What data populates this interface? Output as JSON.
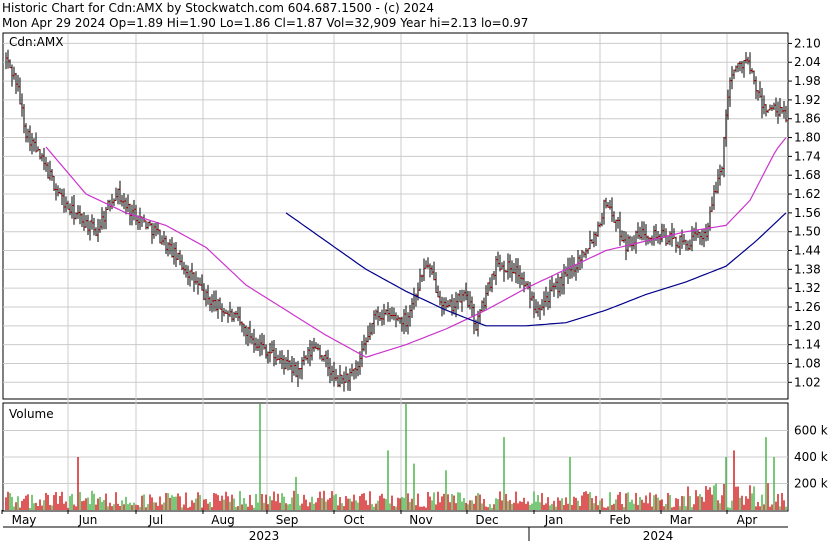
{
  "header": {
    "line1": "Historic Chart for Cdn:AMX by Stockwatch.com 604.687.1500 - (c) 2024",
    "line2": "Mon Apr 29 2024  Op=1.89  Hi=1.90  Lo=1.86  Cl=1.87  Vol=32,909  Year hi=2.13  lo=0.97"
  },
  "chart_data": [
    {
      "type": "ohlc",
      "title": "Cdn:AMX",
      "ylim": [
        0.97,
        2.13
      ],
      "y_ticks": [
        "2.10",
        "2.04",
        "1.98",
        "1.92",
        "1.86",
        "1.80",
        "1.74",
        "1.68",
        "1.62",
        "1.56",
        "1.50",
        "1.44",
        "1.38",
        "1.32",
        "1.26",
        "1.20",
        "1.14",
        "1.08",
        "1.02"
      ],
      "grid": true,
      "colors": {
        "bars": "#000000",
        "close_tick": "#cc0000",
        "ma_short": "#cc33cc",
        "ma_long": "#00008b",
        "grid": "#cccccc"
      },
      "price_anchors": [
        [
          0,
          2.05
        ],
        [
          5,
          1.98
        ],
        [
          10,
          1.82
        ],
        [
          20,
          1.7
        ],
        [
          30,
          1.58
        ],
        [
          45,
          1.5
        ],
        [
          55,
          1.63
        ],
        [
          60,
          1.58
        ],
        [
          75,
          1.5
        ],
        [
          90,
          1.38
        ],
        [
          100,
          1.29
        ],
        [
          115,
          1.22
        ],
        [
          125,
          1.15
        ],
        [
          135,
          1.1
        ],
        [
          145,
          1.05
        ],
        [
          155,
          1.14
        ],
        [
          165,
          1.02
        ],
        [
          175,
          1.05
        ],
        [
          185,
          1.24
        ],
        [
          200,
          1.22
        ],
        [
          210,
          1.4
        ],
        [
          220,
          1.25
        ],
        [
          230,
          1.3
        ],
        [
          235,
          1.2
        ],
        [
          245,
          1.4
        ],
        [
          255,
          1.38
        ],
        [
          265,
          1.26
        ],
        [
          275,
          1.32
        ],
        [
          285,
          1.4
        ],
        [
          295,
          1.5
        ],
        [
          300,
          1.6
        ],
        [
          310,
          1.46
        ],
        [
          320,
          1.5
        ],
        [
          330,
          1.48
        ],
        [
          340,
          1.46
        ],
        [
          350,
          1.5
        ],
        [
          358,
          1.72
        ],
        [
          362,
          2.0
        ],
        [
          370,
          2.05
        ],
        [
          378,
          1.9
        ],
        [
          390,
          1.87
        ]
      ],
      "ma_short_anchors": [
        [
          20,
          1.77
        ],
        [
          40,
          1.62
        ],
        [
          60,
          1.56
        ],
        [
          80,
          1.52
        ],
        [
          100,
          1.45
        ],
        [
          120,
          1.33
        ],
        [
          140,
          1.25
        ],
        [
          160,
          1.17
        ],
        [
          180,
          1.1
        ],
        [
          200,
          1.14
        ],
        [
          220,
          1.19
        ],
        [
          240,
          1.25
        ],
        [
          260,
          1.32
        ],
        [
          280,
          1.38
        ],
        [
          300,
          1.44
        ],
        [
          320,
          1.47
        ],
        [
          340,
          1.5
        ],
        [
          360,
          1.52
        ],
        [
          372,
          1.6
        ],
        [
          385,
          1.76
        ],
        [
          390,
          1.8
        ]
      ],
      "ma_long_anchors": [
        [
          140,
          1.56
        ],
        [
          160,
          1.47
        ],
        [
          180,
          1.38
        ],
        [
          200,
          1.31
        ],
        [
          220,
          1.25
        ],
        [
          240,
          1.2
        ],
        [
          260,
          1.2
        ],
        [
          280,
          1.21
        ],
        [
          300,
          1.25
        ],
        [
          320,
          1.3
        ],
        [
          340,
          1.34
        ],
        [
          360,
          1.39
        ],
        [
          375,
          1.47
        ],
        [
          390,
          1.56
        ]
      ]
    },
    {
      "type": "bar",
      "title": "Volume",
      "ylim": [
        0,
        800000
      ],
      "y_ticks": [
        "600 k",
        "400 k",
        "200 k"
      ],
      "colors": {
        "red": "#cc0000",
        "green": "#33aa33"
      },
      "spikes": [
        [
          36,
          400000,
          "r"
        ],
        [
          127,
          800000,
          "g"
        ],
        [
          145,
          250000,
          "g"
        ],
        [
          191,
          450000,
          "g"
        ],
        [
          200,
          800000,
          "g"
        ],
        [
          204,
          350000,
          "g"
        ],
        [
          220,
          300000,
          "g"
        ],
        [
          249,
          550000,
          "g"
        ],
        [
          282,
          400000,
          "g"
        ],
        [
          360,
          400000,
          "g"
        ],
        [
          364,
          450000,
          "r"
        ],
        [
          380,
          550000,
          "g"
        ],
        [
          384,
          400000,
          "g"
        ]
      ]
    }
  ],
  "x_axis": {
    "months": [
      "May",
      "Jun",
      "Jul",
      "Aug",
      "Sep",
      "Oct",
      "Nov",
      "Dec",
      "Jan",
      "Feb",
      "Mar",
      "Apr"
    ],
    "years": [
      "2023",
      "2024"
    ]
  }
}
